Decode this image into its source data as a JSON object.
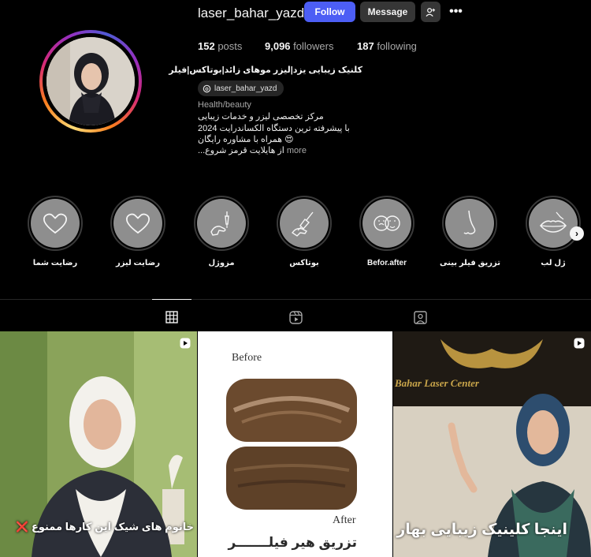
{
  "profile": {
    "username": "laser_bahar_yazd",
    "follow_label": "Follow",
    "message_label": "Message",
    "posts_count": "152",
    "posts_label": "posts",
    "followers_count": "9,096",
    "followers_label": "followers",
    "following_count": "187",
    "following_label": "following",
    "full_name": "کلنیک زیبایی یزد|لیزر موهای زائد|بوتاکس|فیلر",
    "threads_handle": "laser_bahar_yazd",
    "category": "Health/beauty",
    "bio_lines": [
      "مرکز تخصصی لیزر و خدمات زیبایی",
      "با پیشرفته ترین دستگاه الکساندرایت 2024",
      "همراه با مشاوره رایگان 😍",
      "...از هایلایت قرمز شروع"
    ],
    "more_label": "more",
    "accent": "#4c5ef5"
  },
  "highlights": [
    {
      "label": "رضایت شما",
      "icon": "heart-icon"
    },
    {
      "label": "رضایت لیزر",
      "icon": "heart-icon"
    },
    {
      "label": "مزوژل",
      "icon": "syringe-hand-icon"
    },
    {
      "label": "بوتاکس",
      "icon": "syringe-hand-icon"
    },
    {
      "label": "Befor.after",
      "icon": "face-mask-icon"
    },
    {
      "label": "تزریق فیلر بینی",
      "icon": "nose-icon"
    },
    {
      "label": "ژل لب",
      "icon": "lips-icon"
    }
  ],
  "tabs": [
    {
      "name": "posts",
      "icon": "grid-icon",
      "active": true
    },
    {
      "name": "reels",
      "icon": "reels-icon",
      "active": false
    },
    {
      "name": "tagged",
      "icon": "tagged-icon",
      "active": false
    }
  ],
  "posts": [
    {
      "caption": "خانوم های شیک این کارها ممنوع ❌",
      "type": "reel"
    },
    {
      "before_label": "Before",
      "after_label": "After",
      "caption": "تزریق هیر فیلـــــــر",
      "type": "reel"
    },
    {
      "sign_text": "Bahar Laser Center",
      "caption": "اینجا کلینیک زیبایی بهار",
      "type": "reel"
    }
  ]
}
